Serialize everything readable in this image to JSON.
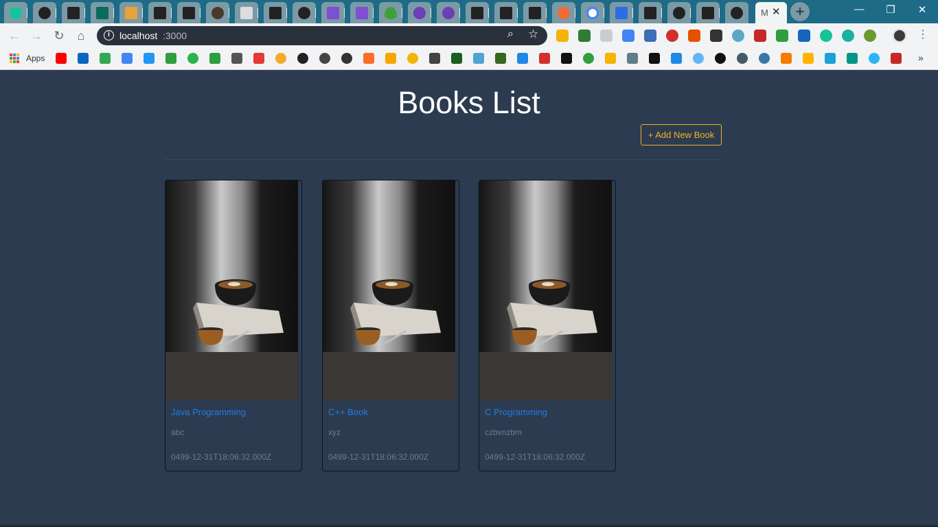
{
  "browser": {
    "active_tab_title": "M",
    "address": {
      "host": "localhost",
      "port": ":3000"
    },
    "window_controls": {
      "minimize": "—",
      "restore": "❐",
      "close": "✕"
    },
    "bookmarks": {
      "apps_label": "Apps"
    }
  },
  "page": {
    "title": "Books List",
    "add_button_label": "+ Add New Book",
    "colors": {
      "background": "#2c3b4f",
      "accent": "#f0b429",
      "link": "#1e7fe6"
    }
  },
  "books": [
    {
      "title": "Java Programming",
      "author": "abc",
      "published": "0499-12-31T18:06:32.000Z"
    },
    {
      "title": "C++ Book",
      "author": "xyz",
      "published": "0499-12-31T18:06:32.000Z"
    },
    {
      "title": "C Programming",
      "author": "czbvnzbm",
      "published": "0499-12-31T18:06:32.000Z"
    }
  ]
}
